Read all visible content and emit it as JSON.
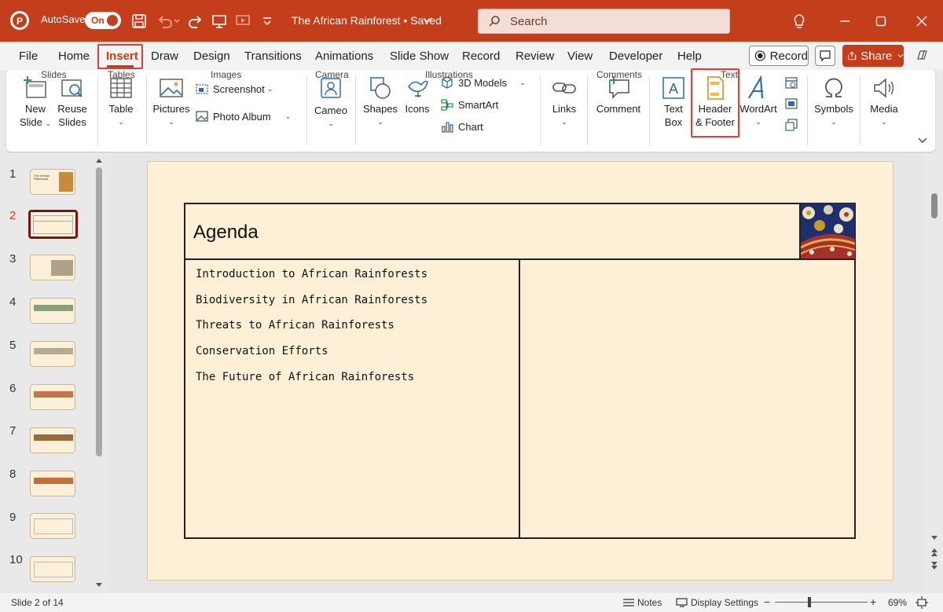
{
  "title_bar": {
    "autosave_label": "AutoSave",
    "autosave_state": "On",
    "document_title": "The African Rainforest • Saved",
    "search_placeholder": "Search",
    "accent": "#c43e1c"
  },
  "menu": {
    "tabs": [
      "File",
      "Home",
      "Insert",
      "Draw",
      "Design",
      "Transitions",
      "Animations",
      "Slide Show",
      "Record",
      "Review",
      "View",
      "Developer",
      "Help"
    ],
    "active_tab": "Insert",
    "record_label": "Record",
    "share_label": "Share"
  },
  "ribbon": {
    "slides": {
      "new_slide": [
        "New",
        "Slide"
      ],
      "reuse_slides": [
        "Reuse",
        "Slides"
      ],
      "group": "Slides"
    },
    "tables": {
      "table": "Table",
      "group": "Tables"
    },
    "images": {
      "pictures": "Pictures",
      "screenshot": "Screenshot",
      "photo_album": "Photo Album",
      "group": "Images"
    },
    "camera": {
      "cameo": "Cameo",
      "group": "Camera"
    },
    "illustrations": {
      "shapes": "Shapes",
      "icons": "Icons",
      "models_3d": "3D Models",
      "smartart": "SmartArt",
      "chart": "Chart",
      "group": "Illustrations"
    },
    "links": {
      "links": "Links"
    },
    "comments": {
      "comment": "Comment",
      "group": "Comments"
    },
    "text": {
      "text_box": [
        "Text",
        "Box"
      ],
      "header_footer": [
        "Header",
        "& Footer"
      ],
      "wordart": "WordArt",
      "group": "Text"
    },
    "symbols": {
      "symbols": "Symbols"
    },
    "media": {
      "media": "Media"
    }
  },
  "thumbnails": [
    "1",
    "2",
    "3",
    "4",
    "5",
    "6",
    "7",
    "8",
    "9",
    "10"
  ],
  "selected_slide": 2,
  "thumb1_title": "The African Rainforest",
  "slide": {
    "title": "Agenda",
    "items": [
      "Introduction to African Rainforests",
      "Biodiversity in African Rainforests",
      "Threats to African Rainforests",
      "Conservation Efforts",
      "The Future of African Rainforests"
    ]
  },
  "status": {
    "slide_counter": "Slide 2 of 14",
    "notes": "Notes",
    "display_settings": "Display Settings",
    "zoom": "69%",
    "zoom_fraction": 0.69
  }
}
